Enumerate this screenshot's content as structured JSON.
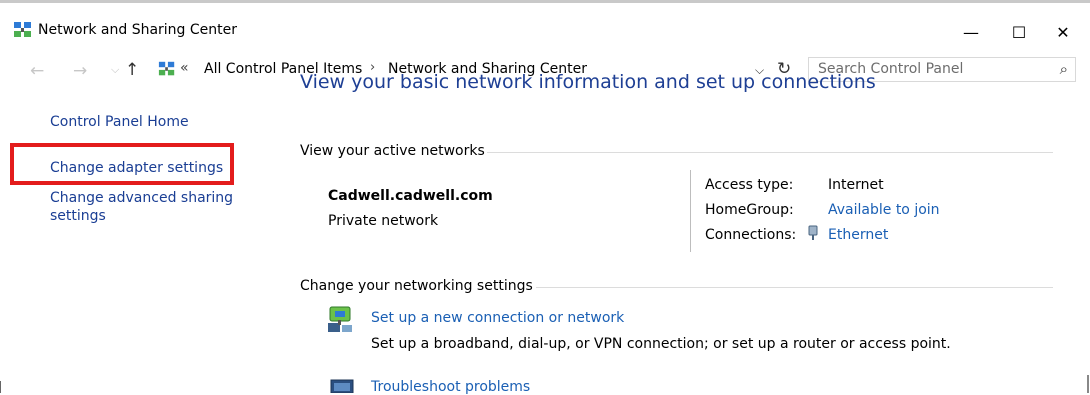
{
  "window": {
    "title": "Network and Sharing Center",
    "minimize": "—",
    "maximize": "☐",
    "close": "✕"
  },
  "nav": {
    "back": "←",
    "forward": "→",
    "recent": "⌵",
    "up": "↑",
    "chevron": "«",
    "breadcrumbs": [
      "All Control Panel Items",
      "Network and Sharing Center"
    ],
    "separator": "›",
    "dropdown": "⌵",
    "refresh": "↻",
    "search_placeholder": "Search Control Panel",
    "search_icon": "⌕"
  },
  "sidebar": {
    "home": "Control Panel Home",
    "adapter": "Change adapter settings",
    "advanced_line1": "Change advanced sharing",
    "advanced_line2": "settings"
  },
  "main": {
    "heading": "View your basic network information and set up connections",
    "active_networks_title": "View your active networks",
    "network_name": "Cadwell.cadwell.com",
    "network_type": "Private network",
    "access_type_label": "Access type:",
    "access_type_value": "Internet",
    "homegroup_label": "HomeGroup:",
    "homegroup_value": "Available to join",
    "connections_label": "Connections:",
    "connections_value": "Ethernet",
    "change_settings_title": "Change your networking settings",
    "setup_link": "Set up a new connection or network",
    "setup_desc": "Set up a broadband, dial-up, or VPN connection; or set up a router or access point.",
    "troubleshoot_link": "Troubleshoot problems"
  },
  "colors": {
    "link": "#1a5fb4",
    "heading": "#1e3f94",
    "highlight": "#e31c1c"
  }
}
